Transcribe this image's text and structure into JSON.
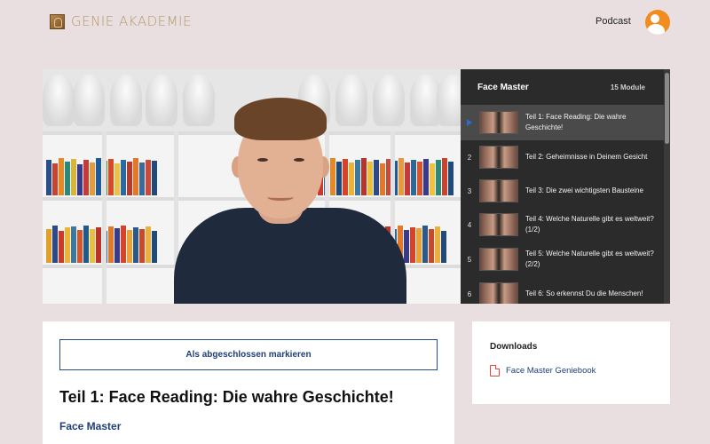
{
  "header": {
    "brand": "GENIE AKADEMIE",
    "podcast_label": "Podcast",
    "avatar_icon": "user-avatar-icon",
    "avatar_color": "#f28c1f"
  },
  "playlist": {
    "title": "Face Master",
    "count_label": "15 Module",
    "items": [
      {
        "num": "1",
        "label": "Teil 1: Face Reading: Die wahre Geschichte!",
        "active": true
      },
      {
        "num": "2",
        "label": "Teil 2: Geheimnisse in Deinem Gesicht"
      },
      {
        "num": "3",
        "label": "Teil 3: Die zwei wichtigsten Bausteine"
      },
      {
        "num": "4",
        "label": "Teil 4: Welche Naturelle gibt es weltweit? (1/2)"
      },
      {
        "num": "5",
        "label": "Teil 5: Welche Naturelle gibt es weltweit? (2/2)"
      },
      {
        "num": "6",
        "label": "Teil 6: So erkennst Du die Menschen!"
      }
    ]
  },
  "lesson": {
    "complete_button": "Als abgeschlossen markieren",
    "title": "Teil 1: Face Reading: Die wahre Geschichte!",
    "course": "Face Master"
  },
  "downloads": {
    "title": "Downloads",
    "items": [
      {
        "label": "Face Master Geniebook",
        "icon": "pdf-file-icon"
      }
    ]
  },
  "colors": {
    "background": "#e9dfe0",
    "accent_blue": "#1f3f78",
    "playlist_bg": "#2b2b2b"
  }
}
